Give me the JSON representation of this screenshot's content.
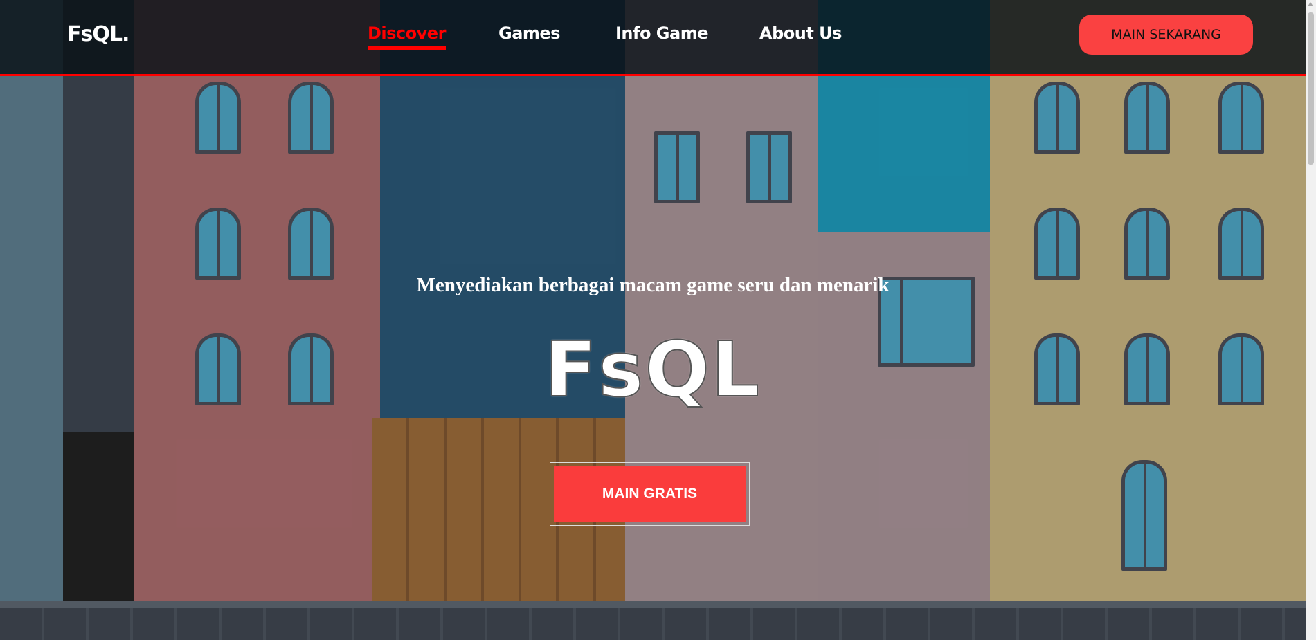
{
  "nav": {
    "logo": "FsQL.",
    "links": [
      {
        "label": "Discover",
        "active": true
      },
      {
        "label": "Games"
      },
      {
        "label": "Info Game"
      },
      {
        "label": "About Us"
      }
    ],
    "cta": "MAIN SEKARANG"
  },
  "hero": {
    "subtitle": "Menyediakan berbagai macam game seru dan menarik",
    "title": "FsQL",
    "button": "MAIN GRATIS"
  },
  "colors": {
    "accent": "#ff0000",
    "button": "#fa4141"
  }
}
